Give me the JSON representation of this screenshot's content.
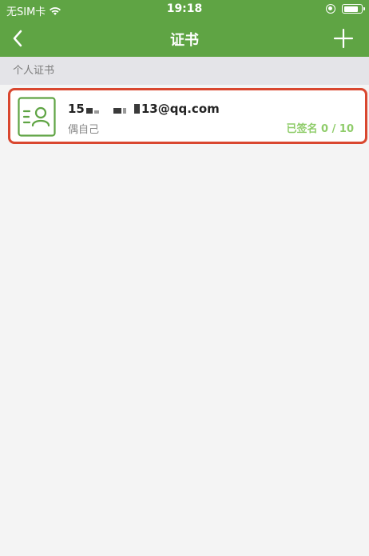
{
  "status_bar": {
    "carrier": "无SIM卡",
    "time": "19:18"
  },
  "nav": {
    "title": "证书",
    "back_icon": "chevron-left-icon",
    "add_icon": "plus-icon"
  },
  "section": {
    "title": "个人证书"
  },
  "certificates": [
    {
      "email_prefix": "15",
      "email_suffix": "13@qq.com",
      "owner": "偶自己",
      "status": "已签名 0 / 10",
      "icon": "contact-card-icon"
    }
  ],
  "colors": {
    "header_green": "#5fa444",
    "highlight_red": "#d9472f",
    "status_green": "#8fcc6a"
  }
}
